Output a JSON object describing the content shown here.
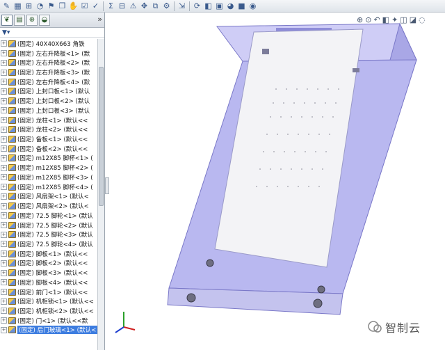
{
  "tree": {
    "items": [
      {
        "state": "(固定)",
        "name": "40X40X663",
        "suffix": "角铁"
      },
      {
        "state": "(固定)",
        "name": "左右升降板<1>",
        "suffix": "(默"
      },
      {
        "state": "(固定)",
        "name": "左右升降板<2>",
        "suffix": "(默"
      },
      {
        "state": "(固定)",
        "name": "左右升降板<3>",
        "suffix": "(默"
      },
      {
        "state": "(固定)",
        "name": "左右升降板<4>",
        "suffix": "(默"
      },
      {
        "state": "(固定)",
        "name": "上封口板<1>",
        "suffix": "(默认"
      },
      {
        "state": "(固定)",
        "name": "上封口板<2>",
        "suffix": "(默认"
      },
      {
        "state": "(固定)",
        "name": "上封口板<3>",
        "suffix": "(默认"
      },
      {
        "state": "(固定)",
        "name": "龙柱<1>",
        "suffix": "(默认<<"
      },
      {
        "state": "(固定)",
        "name": "龙柱<2>",
        "suffix": "(默认<<"
      },
      {
        "state": "(固定)",
        "name": "备板<1>",
        "suffix": "(默认<<"
      },
      {
        "state": "(固定)",
        "name": "备板<2>",
        "suffix": "(默认<<"
      },
      {
        "state": "(固定)",
        "name": "m12X85 脚杯<1>",
        "suffix": "("
      },
      {
        "state": "(固定)",
        "name": "m12X85 脚杯<2>",
        "suffix": "("
      },
      {
        "state": "(固定)",
        "name": "m12X85 脚杯<3>",
        "suffix": "("
      },
      {
        "state": "(固定)",
        "name": "m12X85 脚杯<4>",
        "suffix": "("
      },
      {
        "state": "(固定)",
        "name": "风扇架<1>",
        "suffix": "(默认<"
      },
      {
        "state": "(固定)",
        "name": "风扇架<2>",
        "suffix": "(默认<"
      },
      {
        "state": "(固定)",
        "name": "72.5 脚轮<1>",
        "suffix": "(默认"
      },
      {
        "state": "(固定)",
        "name": "72.5 脚轮<2>",
        "suffix": "(默认"
      },
      {
        "state": "(固定)",
        "name": "72.5 脚轮<3>",
        "suffix": "(默认"
      },
      {
        "state": "(固定)",
        "name": "72.5 脚轮<4>",
        "suffix": "(默认"
      },
      {
        "state": "(固定)",
        "name": "脚板<1>",
        "suffix": "(默认<<"
      },
      {
        "state": "(固定)",
        "name": "脚板<2>",
        "suffix": "(默认<<"
      },
      {
        "state": "(固定)",
        "name": "脚板<3>",
        "suffix": "(默认<<"
      },
      {
        "state": "(固定)",
        "name": "脚板<4>",
        "suffix": "(默认<<"
      },
      {
        "state": "(固定)",
        "name": "前门<1>",
        "suffix": "(默认<<"
      },
      {
        "state": "(固定)",
        "name": "机柜锁<1>",
        "suffix": "(默认<<"
      },
      {
        "state": "(固定)",
        "name": "机柜锁<2>",
        "suffix": "(默认<<"
      },
      {
        "state": "(固定)",
        "name": "门<1>",
        "suffix": "(默认<<默"
      },
      {
        "state": "(固定)",
        "name": "后门玻璃<1>",
        "suffix": "(默认<"
      }
    ],
    "selected_index": 30
  },
  "panel": {
    "more_label": "»"
  },
  "watermark": {
    "text": "智制云"
  },
  "colors": {
    "selection": "#3d7de0",
    "cabinet_body": "#b9b8f0",
    "door_panel": "#f3f3f6"
  }
}
